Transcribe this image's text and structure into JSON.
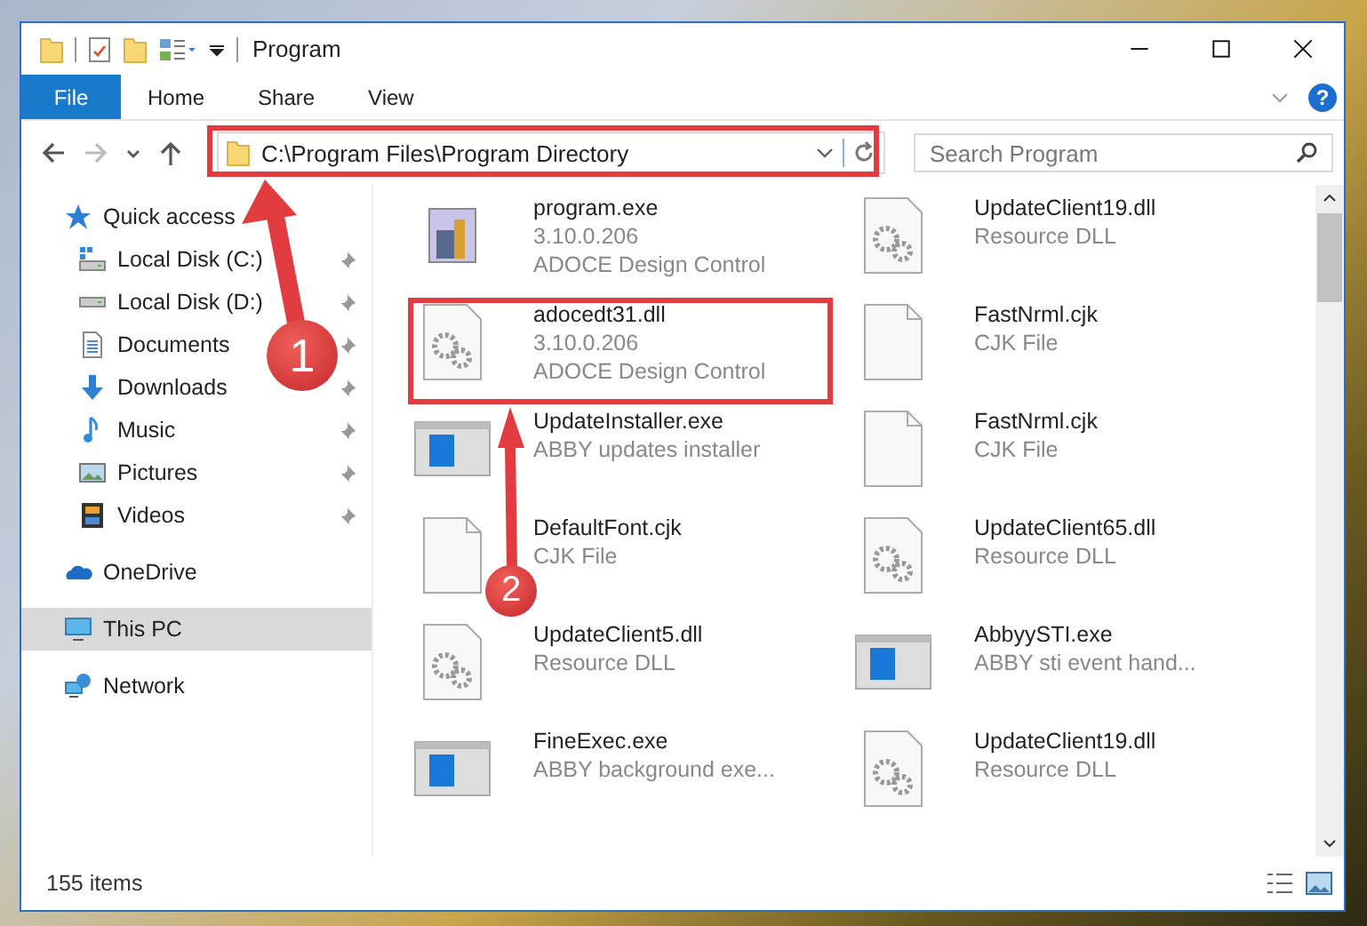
{
  "window": {
    "title": "Program"
  },
  "ribbon": {
    "tabs": [
      {
        "label": "File",
        "kind": "file"
      },
      {
        "label": "Home",
        "kind": "tab"
      },
      {
        "label": "Share",
        "kind": "tab"
      },
      {
        "label": "View",
        "kind": "tab"
      }
    ],
    "help": "?"
  },
  "navigation": [
    {
      "kind": "back",
      "disabled": false
    },
    {
      "kind": "forward",
      "disabled": true
    },
    {
      "kind": "recent",
      "disabled": false
    },
    {
      "kind": "up",
      "disabled": false
    }
  ],
  "address": {
    "path": "C:\\Program Files\\Program Directory"
  },
  "search": {
    "placeholder": "Search Program"
  },
  "sidebar": {
    "items": [
      {
        "label": "Quick access",
        "kind": "star",
        "selected": false,
        "children": [
          {
            "label": "Local Disk (C:)",
            "kind": "system",
            "pinned": true,
            "selected": false
          },
          {
            "label": "Local Disk (D:)",
            "kind": "drive",
            "pinned": true,
            "selected": false
          },
          {
            "label": "Documents",
            "kind": "document",
            "pinned": true,
            "selected": false
          },
          {
            "label": "Downloads",
            "kind": "download",
            "pinned": true,
            "selected": false
          },
          {
            "label": "Music",
            "kind": "music",
            "pinned": true,
            "selected": false
          },
          {
            "label": "Pictures",
            "kind": "picture",
            "pinned": true,
            "selected": false
          },
          {
            "label": "Videos",
            "kind": "video",
            "pinned": true,
            "selected": false
          }
        ]
      },
      {
        "label": "OneDrive",
        "kind": "cloud",
        "selected": false
      },
      {
        "label": "This PC",
        "kind": "computer",
        "selected": true
      },
      {
        "label": "Network",
        "kind": "network",
        "selected": false
      }
    ]
  },
  "files": [
    {
      "name": "program.exe",
      "details": [
        "3.10.0.206",
        "ADOCE Design Control"
      ],
      "kind": "program"
    },
    {
      "name": "UpdateClient19.dll",
      "details": [
        "Resource DLL"
      ],
      "kind": "dll"
    },
    {
      "name": "adocedt31.dll",
      "details": [
        "3.10.0.206",
        "ADOCE Design Control"
      ],
      "kind": "dll"
    },
    {
      "name": "FastNrml.cjk",
      "details": [
        "CJK File"
      ],
      "kind": "blank"
    },
    {
      "name": "UpdateInstaller.exe",
      "details": [
        "ABBY updates installer"
      ],
      "kind": "app"
    },
    {
      "name": "FastNrml.cjk",
      "details": [
        "CJK File"
      ],
      "kind": "blank"
    },
    {
      "name": "DefaultFont.cjk",
      "details": [
        "CJK File"
      ],
      "kind": "blank"
    },
    {
      "name": "UpdateClient65.dll",
      "details": [
        "Resource DLL"
      ],
      "kind": "dll"
    },
    {
      "name": "UpdateClient5.dll",
      "details": [
        "Resource DLL"
      ],
      "kind": "dll"
    },
    {
      "name": "AbbyySTI.exe",
      "details": [
        "ABBY sti event hand..."
      ],
      "kind": "app"
    },
    {
      "name": "FineExec.exe",
      "details": [
        "ABBY background exe..."
      ],
      "kind": "app"
    },
    {
      "name": "UpdateClient19.dll",
      "details": [
        "Resource DLL"
      ],
      "kind": "dll"
    }
  ],
  "status_bar": {
    "count": "155 items"
  },
  "annotations": [
    {
      "number": "1"
    },
    {
      "number": "2"
    }
  ]
}
